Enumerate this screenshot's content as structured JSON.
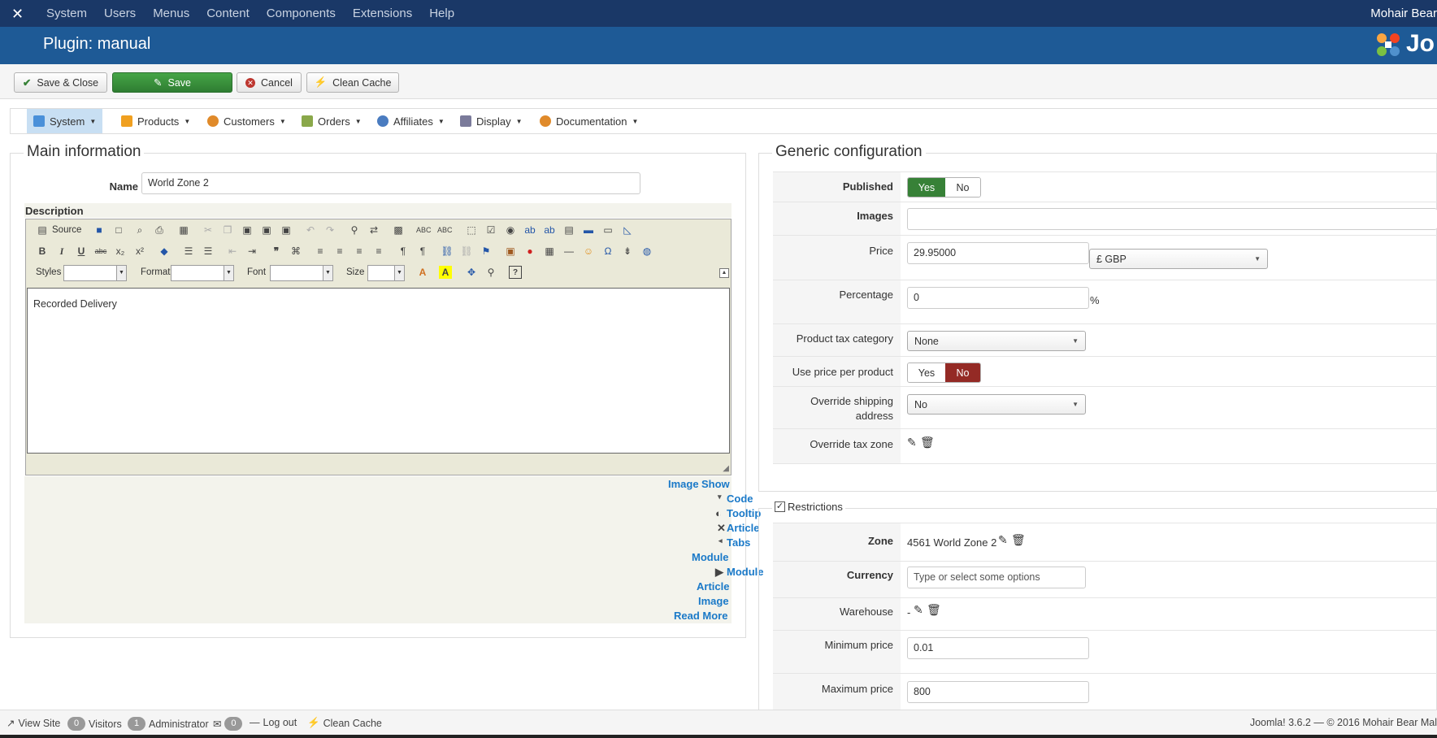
{
  "topnav": {
    "menu": [
      "System",
      "Users",
      "Menus",
      "Content",
      "Components",
      "Extensions",
      "Help"
    ],
    "user": "Mohair Bear"
  },
  "header": {
    "title": "Plugin: manual",
    "logo_text": "Jo"
  },
  "toolbar": {
    "save_close": "Save & Close",
    "save": "Save",
    "cancel": "Cancel",
    "clean_cache": "Clean Cache"
  },
  "shopmenu": {
    "items": [
      {
        "label": "System",
        "icon": "wrench-icon",
        "color": "#4a90d9"
      },
      {
        "label": "Products",
        "icon": "box-icon",
        "color": "#f0a020"
      },
      {
        "label": "Customers",
        "icon": "users-icon",
        "color": "#e08a2a"
      },
      {
        "label": "Orders",
        "icon": "pencil-icon",
        "color": "#8aa84a"
      },
      {
        "label": "Affiliates",
        "icon": "affiliate-icon",
        "color": "#4a7cc0"
      },
      {
        "label": "Display",
        "icon": "display-icon",
        "color": "#7a7a9a"
      },
      {
        "label": "Documentation",
        "icon": "doc-icon",
        "color": "#e08a2a"
      }
    ]
  },
  "main": {
    "legend": "Main information",
    "name_label": "Name",
    "name_value": "World Zone 2",
    "description_label": "Description",
    "editor": {
      "source_label": "Source",
      "styles_label": "Styles",
      "format_label": "Format",
      "font_label": "Font",
      "size_label": "Size",
      "content": "Recorded Delivery"
    },
    "buttons": [
      {
        "text": "Image",
        "icon": ""
      },
      {
        "text": "Show",
        "icon": ""
      },
      {
        "text": "Code",
        "icon": "▾"
      },
      {
        "text": "Tooltip",
        "icon": "◐"
      },
      {
        "text": "Article",
        "icon": "✕"
      },
      {
        "text": "Tabs",
        "icon": "◂"
      },
      {
        "text": "Module",
        "icon": ""
      },
      {
        "text": "Module",
        "icon": "▶"
      },
      {
        "text": "Article",
        "icon": ""
      },
      {
        "text": "Image",
        "icon": ""
      },
      {
        "text": "Read More",
        "icon": ""
      }
    ]
  },
  "generic": {
    "legend": "Generic configuration",
    "published_label": "Published",
    "published_yes": "Yes",
    "published_no": "No",
    "images_label": "Images",
    "price_label": "Price",
    "price_value": "29.95000",
    "currency_value": "£ GBP",
    "percentage_label": "Percentage",
    "percentage_value": "0",
    "percent_symbol": "%",
    "tax_label": "Product tax category",
    "tax_value": "None",
    "use_price_label": "Use price per product",
    "use_price_yes": "Yes",
    "use_price_no": "No",
    "override_shipping_label": "Override shipping address",
    "override_shipping_value": "No",
    "override_tax_label": "Override tax zone"
  },
  "restrictions": {
    "legend": "Restrictions",
    "zone_label": "Zone",
    "zone_value": "4561 World Zone 2",
    "currency_label": "Currency",
    "currency_placeholder": "Type or select some options",
    "warehouse_label": "Warehouse",
    "warehouse_value": "-",
    "min_label": "Minimum price",
    "min_value": "0.01",
    "max_label": "Maximum price",
    "max_value": "800"
  },
  "status": {
    "view_site": "View Site",
    "visitors_count": "0",
    "visitors": "Visitors",
    "admin_count": "1",
    "administrator": "Administrator",
    "messages_count": "0",
    "logout": "Log out",
    "clean_cache": "Clean Cache",
    "version": "Joomla! 3.6.2 — © 2016 Mohair Bear Mal"
  },
  "colors": {
    "yes_active": "#378137",
    "no_active": "#942a25"
  }
}
